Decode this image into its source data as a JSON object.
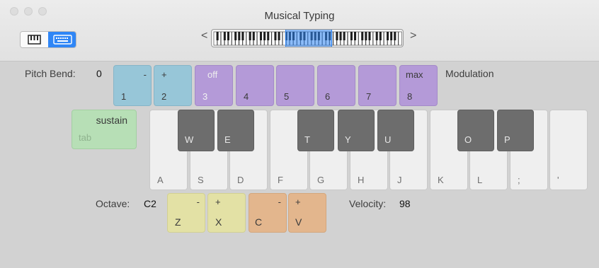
{
  "window": {
    "title": "Musical Typing"
  },
  "toolbar": {
    "prev_arrow": "<",
    "next_arrow": ">"
  },
  "pitch": {
    "label": "Pitch Bend:",
    "value": "0"
  },
  "modulation": {
    "label": "Modulation"
  },
  "pads": [
    {
      "top": "-",
      "bottom": "1"
    },
    {
      "top": "+",
      "bottom": "2"
    },
    {
      "top": "off",
      "bottom": "3"
    },
    {
      "top": "",
      "bottom": "4"
    },
    {
      "top": "",
      "bottom": "5"
    },
    {
      "top": "",
      "bottom": "6"
    },
    {
      "top": "",
      "bottom": "7"
    },
    {
      "top": "max",
      "bottom": "8"
    }
  ],
  "sustain": {
    "label": "sustain",
    "key": "tab"
  },
  "white_keys": [
    "A",
    "S",
    "D",
    "F",
    "G",
    "H",
    "J",
    "K",
    "L",
    ";",
    "'"
  ],
  "black_keys": [
    "W",
    "E",
    "T",
    "Y",
    "U",
    "O",
    "P"
  ],
  "octave": {
    "label": "Octave:",
    "value": "C2",
    "down": {
      "sign": "-",
      "key": "Z"
    },
    "up": {
      "sign": "+",
      "key": "X"
    }
  },
  "velocity": {
    "label": "Velocity:",
    "value": "98",
    "down": {
      "sign": "-",
      "key": "C"
    },
    "up": {
      "sign": "+",
      "key": "V"
    }
  },
  "colors": {
    "accent": "#2f86f6",
    "pitch": "#97c6d8",
    "modulation": "#b49ad8",
    "octave": "#e3e1a5",
    "velocity": "#e3b68d",
    "sustain": "#b7dfb6"
  }
}
